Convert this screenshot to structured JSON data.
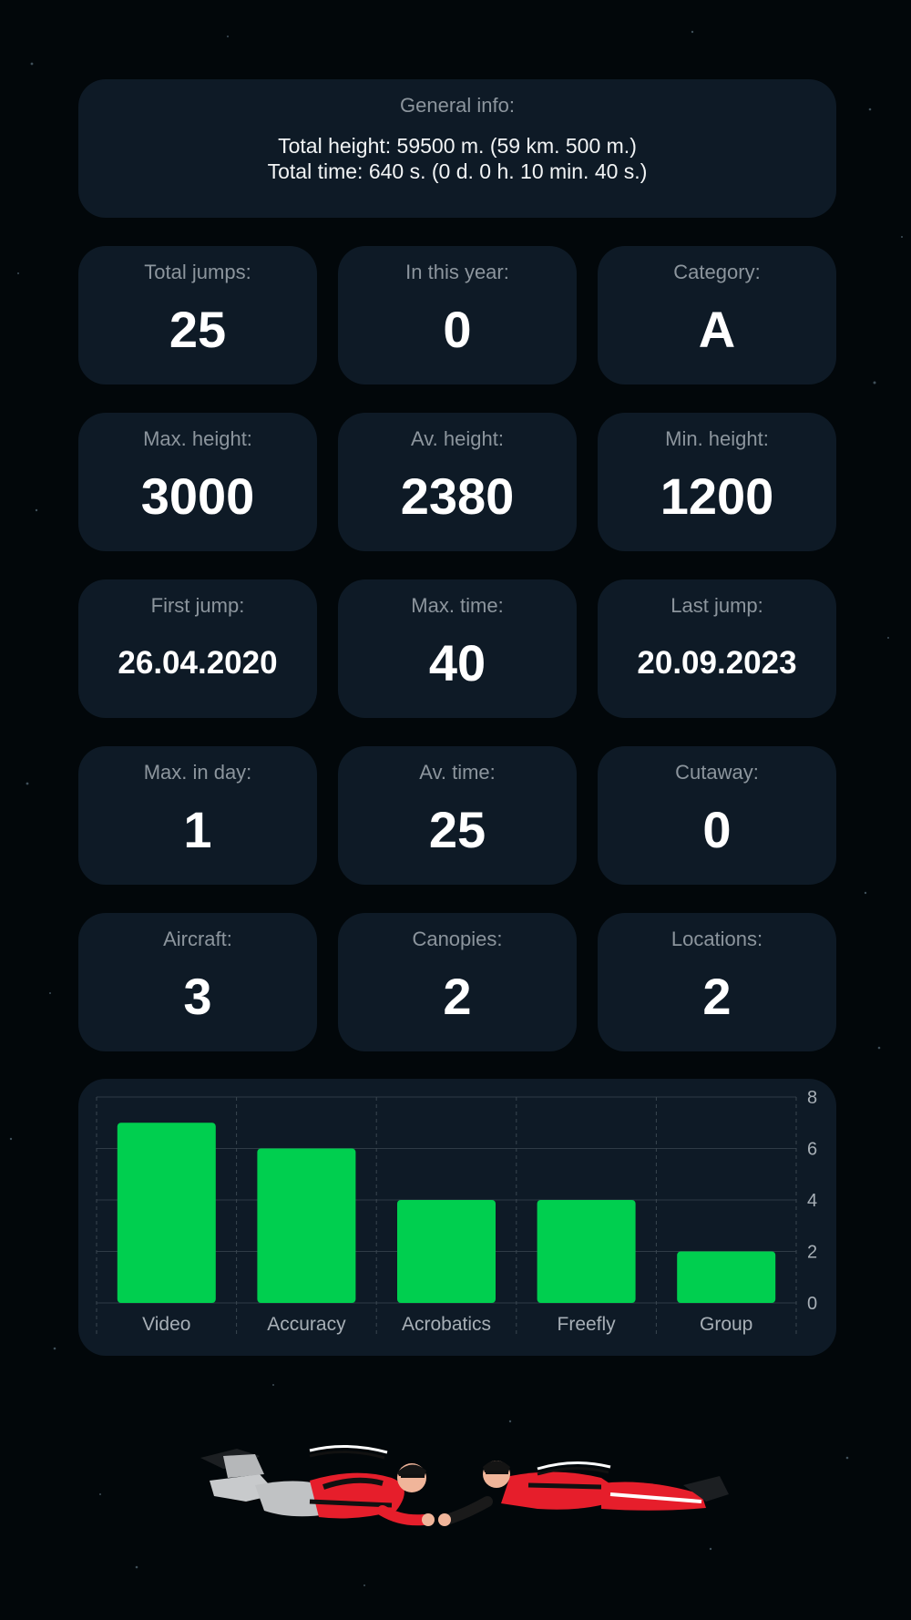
{
  "general": {
    "title": "General info:",
    "total_height": "Total height: 59500 m. (59 km. 500 m.)",
    "total_time": "Total time: 640 s. (0 d. 0 h. 10 min. 40 s.)"
  },
  "stats": [
    {
      "label": "Total jumps:",
      "value": "25"
    },
    {
      "label": "In this year:",
      "value": "0"
    },
    {
      "label": "Category:",
      "value": "A"
    },
    {
      "label": "Max. height:",
      "value": "3000"
    },
    {
      "label": "Av. height:",
      "value": "2380"
    },
    {
      "label": "Min. height:",
      "value": "1200"
    },
    {
      "label": "First jump:",
      "value": "26.04.2020"
    },
    {
      "label": "Max. time:",
      "value": "40"
    },
    {
      "label": "Last jump:",
      "value": "20.09.2023"
    },
    {
      "label": "Max. in day:",
      "value": "1"
    },
    {
      "label": "Av. time:",
      "value": "25"
    },
    {
      "label": "Cutaway:",
      "value": "0"
    },
    {
      "label": "Aircraft:",
      "value": "3"
    },
    {
      "label": "Canopies:",
      "value": "2"
    },
    {
      "label": "Locations:",
      "value": "2"
    }
  ],
  "chart_data": {
    "type": "bar",
    "categories": [
      "Video",
      "Accuracy",
      "Acrobatics",
      "Freefly",
      "Group"
    ],
    "values": [
      7,
      6,
      4,
      4,
      2
    ],
    "ylim": [
      0,
      8
    ],
    "yticks": [
      "0",
      "2",
      "4",
      "6",
      "8"
    ],
    "y_axis_side": "right",
    "grid": true,
    "bar_color": "#00cf4f"
  },
  "colors": {
    "background": "#02070a",
    "card": "#0e1a26",
    "label": "#8c959d",
    "value": "#ffffff"
  }
}
